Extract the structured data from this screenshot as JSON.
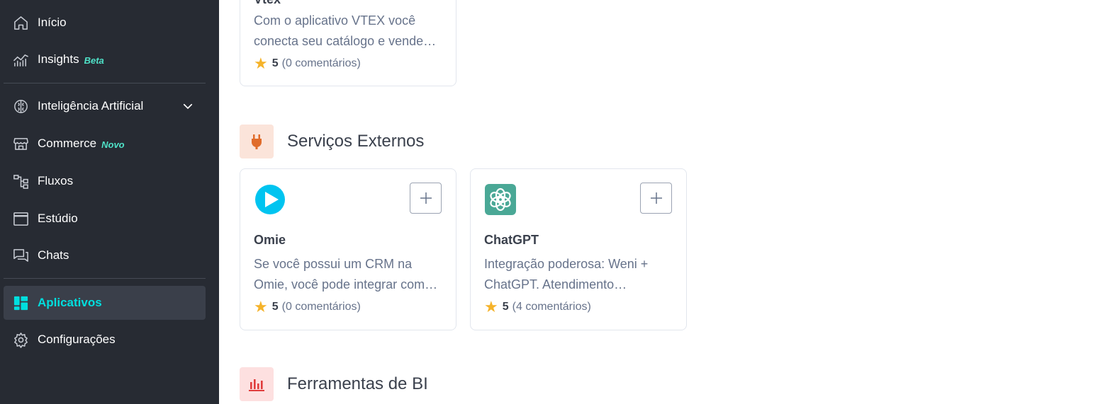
{
  "sidebar": {
    "items": [
      {
        "label": "Início",
        "icon": "home-icon"
      },
      {
        "label": "Insights",
        "tag": "Beta",
        "icon": "chart-line-icon"
      },
      {
        "label": "Inteligência Artificial",
        "icon": "brain-icon"
      },
      {
        "label": "Commerce",
        "tag": "Novo",
        "icon": "storefront-icon"
      },
      {
        "label": "Fluxos",
        "icon": "flow-icon"
      },
      {
        "label": "Estúdio",
        "icon": "window-icon"
      },
      {
        "label": "Chats",
        "icon": "chats-icon"
      },
      {
        "label": "Aplicativos",
        "icon": "apps-grid-icon",
        "active": true
      },
      {
        "label": "Configurações",
        "icon": "gear-icon"
      }
    ]
  },
  "main": {
    "vtex_card": {
      "title": "Vtex",
      "desc_line1": "Com o aplicativo VTEX você",
      "desc_line2": "conecta seu catálogo e vende…",
      "score": "5",
      "reviews": "(0 comentários)"
    },
    "external_section": {
      "title": "Serviços Externos",
      "icon": "plug-icon",
      "icon_bg": "#fbe4da",
      "icon_color": "#e06c2b"
    },
    "cards": [
      {
        "title": "Omie",
        "desc_line1": "Se você possui um CRM na",
        "desc_line2": "Omie, você pode integrar com…",
        "score": "5",
        "reviews": "(0 comentários)",
        "logo": "omie-logo-icon"
      },
      {
        "title": "ChatGPT",
        "desc_line1": "Integração poderosa: Weni +",
        "desc_line2": "ChatGPT. Atendimento…",
        "score": "5",
        "reviews": "(4 comentários)",
        "logo": "chatgpt-logo-icon"
      }
    ],
    "bi_section": {
      "title": "Ferramentas de BI",
      "icon": "bar-chart-icon",
      "icon_bg": "#fde0e0",
      "icon_color": "#e03c3c"
    }
  },
  "colors": {
    "sidebar_bg": "#272b33",
    "active_accent": "#00dede",
    "tag_color": "#4fe2c8",
    "star": "#f5b32a"
  }
}
